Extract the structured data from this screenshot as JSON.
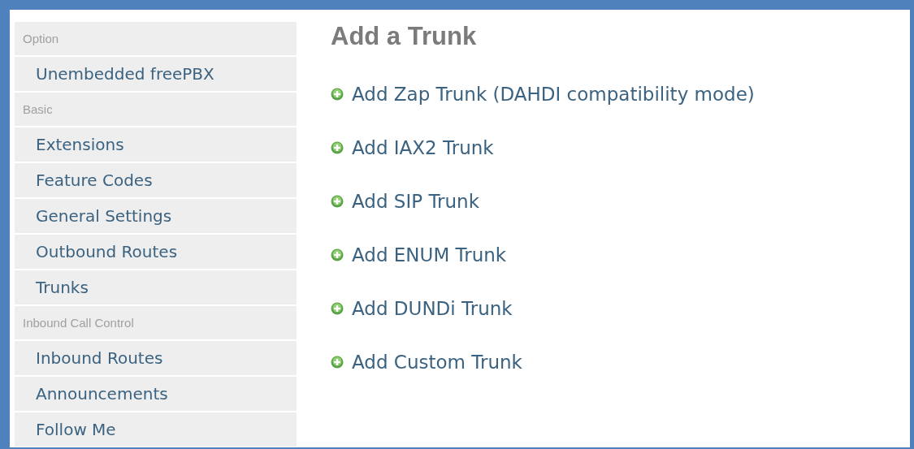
{
  "sidebar": {
    "items": [
      {
        "kind": "header",
        "label": "Option"
      },
      {
        "kind": "link",
        "label": "Unembedded freePBX"
      },
      {
        "kind": "header",
        "label": "Basic"
      },
      {
        "kind": "link",
        "label": "Extensions"
      },
      {
        "kind": "link",
        "label": "Feature Codes"
      },
      {
        "kind": "link",
        "label": "General Settings"
      },
      {
        "kind": "link",
        "label": "Outbound Routes"
      },
      {
        "kind": "link",
        "label": "Trunks"
      },
      {
        "kind": "header",
        "label": "Inbound Call Control"
      },
      {
        "kind": "link",
        "label": "Inbound Routes"
      },
      {
        "kind": "link",
        "label": "Announcements"
      },
      {
        "kind": "link",
        "label": "Follow Me"
      }
    ]
  },
  "content": {
    "title": "Add a Trunk",
    "links": [
      "Add Zap Trunk (DAHDI compatibility mode)",
      "Add IAX2 Trunk",
      "Add SIP Trunk",
      "Add ENUM Trunk",
      "Add DUNDi Trunk",
      "Add Custom Trunk"
    ]
  }
}
